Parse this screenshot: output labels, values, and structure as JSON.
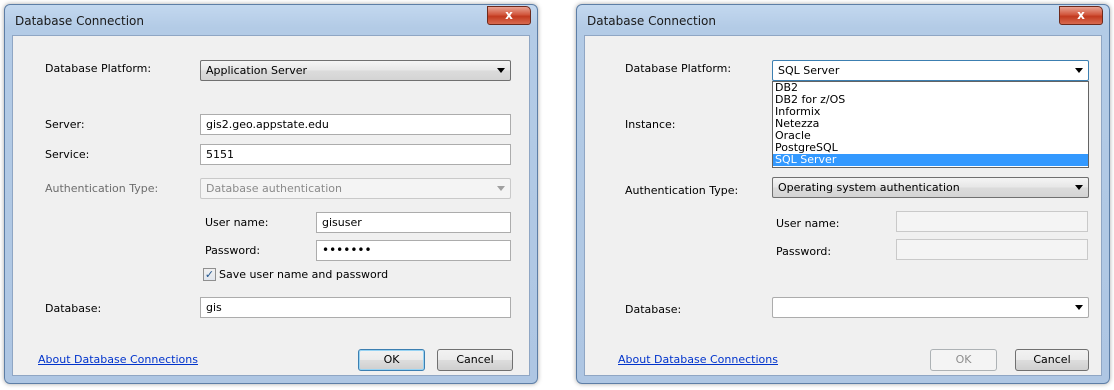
{
  "left_dialog": {
    "title": "Database Connection",
    "close_glyph": "x",
    "platform_label": "Database Platform:",
    "platform_value": "Application Server",
    "server_label": "Server:",
    "server_value": "gis2.geo.appstate.edu",
    "service_label": "Service:",
    "service_value": "5151",
    "auth_label": "Authentication Type:",
    "auth_value": "Database authentication",
    "username_label": "User name:",
    "username_value": "gisuser",
    "password_label": "Password:",
    "password_value": "•••••••",
    "save_label": "Save user name and password",
    "save_checked": "✓",
    "database_label": "Database:",
    "database_value": "gis",
    "about_link": "About Database Connections",
    "ok_label": "OK",
    "cancel_label": "Cancel"
  },
  "right_dialog": {
    "title": "Database Connection",
    "close_glyph": "x",
    "platform_label": "Database Platform:",
    "platform_value": "SQL Server",
    "platform_options": [
      "DB2",
      "DB2 for z/OS",
      "Informix",
      "Netezza",
      "Oracle",
      "PostgreSQL",
      "SQL Server"
    ],
    "platform_selected": "SQL Server",
    "instance_label": "Instance:",
    "auth_label": "Authentication Type:",
    "auth_value": "Operating system authentication",
    "username_label": "User name:",
    "password_label": "Password:",
    "database_label": "Database:",
    "about_link": "About Database Connections",
    "ok_label": "OK",
    "cancel_label": "Cancel"
  },
  "icons": {
    "close": "close-icon",
    "dropdown": "chevron-down-icon",
    "check": "check-icon"
  }
}
